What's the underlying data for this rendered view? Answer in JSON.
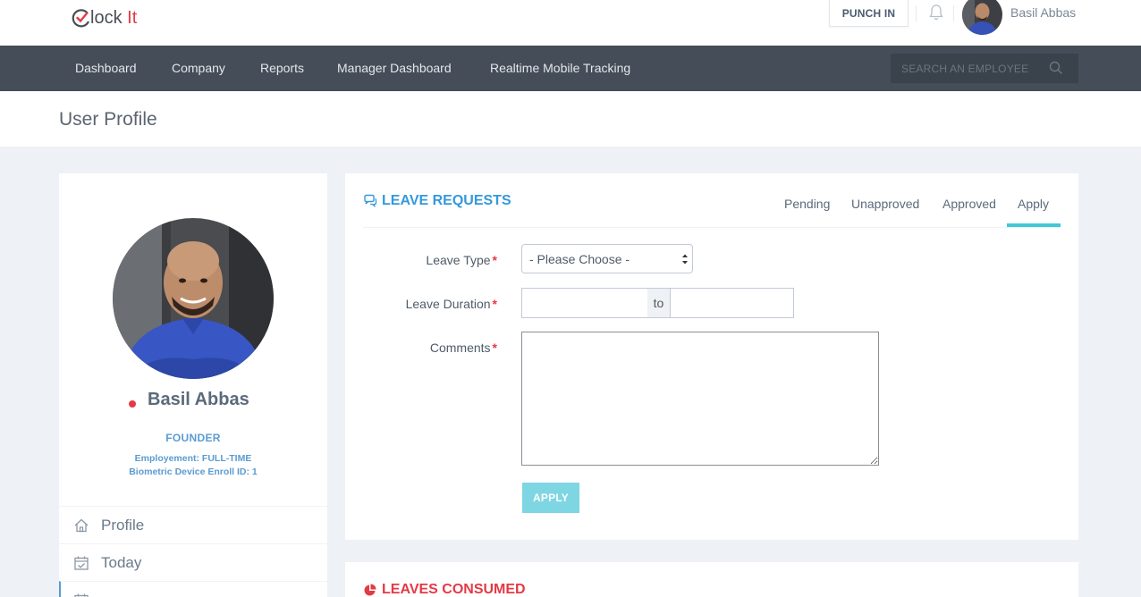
{
  "header": {
    "logo": {
      "part1": "lock",
      "part2": "It"
    },
    "punch_in_label": "PUNCH IN",
    "user_name": "Basil Abbas"
  },
  "nav": {
    "items": [
      "Dashboard",
      "Company",
      "Reports",
      "Manager Dashboard",
      "Realtime Mobile Tracking"
    ],
    "search_placeholder": "SEARCH AN EMPLOYEE"
  },
  "page": {
    "title": "User Profile"
  },
  "profile": {
    "name": "Basil Abbas",
    "status_color": "#e43a45",
    "role": "FOUNDER",
    "employment": "Employement: FULL-TIME",
    "biometric": "Biometric Device Enroll ID: 1",
    "menu": [
      {
        "label": "Profile",
        "icon": "home-icon"
      },
      {
        "label": "Today",
        "icon": "calendar-check-icon"
      },
      {
        "label": "",
        "icon": "calendar-icon"
      }
    ]
  },
  "leave_requests": {
    "title": "LEAVE REQUESTS",
    "tabs": [
      "Pending",
      "Unapproved",
      "Approved",
      "Apply"
    ],
    "active_tab": "Apply",
    "form": {
      "leave_type_label": "Leave Type",
      "leave_type_value": "- Please Choose -",
      "duration_label": "Leave Duration",
      "duration_separator": "to",
      "duration_start": "",
      "duration_end": "",
      "comments_label": "Comments",
      "comments_value": "",
      "required_mark": "*",
      "apply_label": "APPLY"
    }
  },
  "leaves_consumed": {
    "title": "LEAVES CONSUMED"
  },
  "colors": {
    "accent_blue": "#3598dc",
    "accent_red": "#e43a45",
    "nav_bg": "#444d58",
    "tab_underline": "#3fc9d5",
    "apply_button": "#7ed6e3"
  }
}
